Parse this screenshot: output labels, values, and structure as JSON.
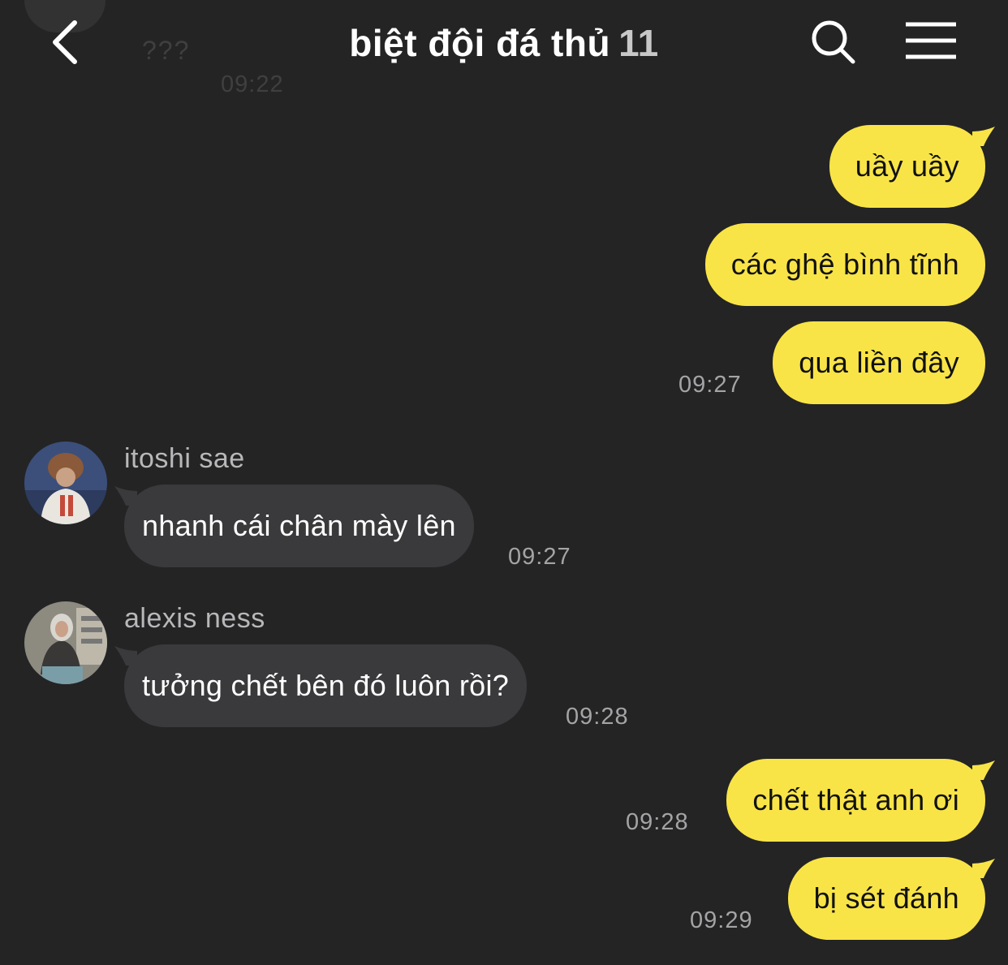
{
  "header": {
    "title": "biệt đội đá thủ",
    "member_count": "11",
    "back_icon": "chevron-left-icon",
    "search_icon": "search-icon",
    "menu_icon": "hamburger-menu-icon"
  },
  "previous_message": {
    "text": "???",
    "time": "09:22"
  },
  "messages": [
    {
      "text": "uầy uầy"
    },
    {
      "text": "các ghệ bình tĩnh"
    },
    {
      "text": "qua liền đây",
      "time": "09:27"
    },
    {
      "sender": "itoshi sae",
      "text": "nhanh cái chân mày lên",
      "time": "09:27"
    },
    {
      "sender": "alexis ness",
      "text": "tưởng chết bên đó luôn rồi?",
      "time": "09:28"
    },
    {
      "text": "chết thật anh ơi",
      "time": "09:28"
    },
    {
      "text": "bị sét đánh",
      "time": "09:29"
    }
  ],
  "colors": {
    "background": "#242425",
    "outgoing_bubble": "#f9e447",
    "incoming_bubble": "#3a3a3c",
    "timestamp": "#a4a4a6"
  }
}
